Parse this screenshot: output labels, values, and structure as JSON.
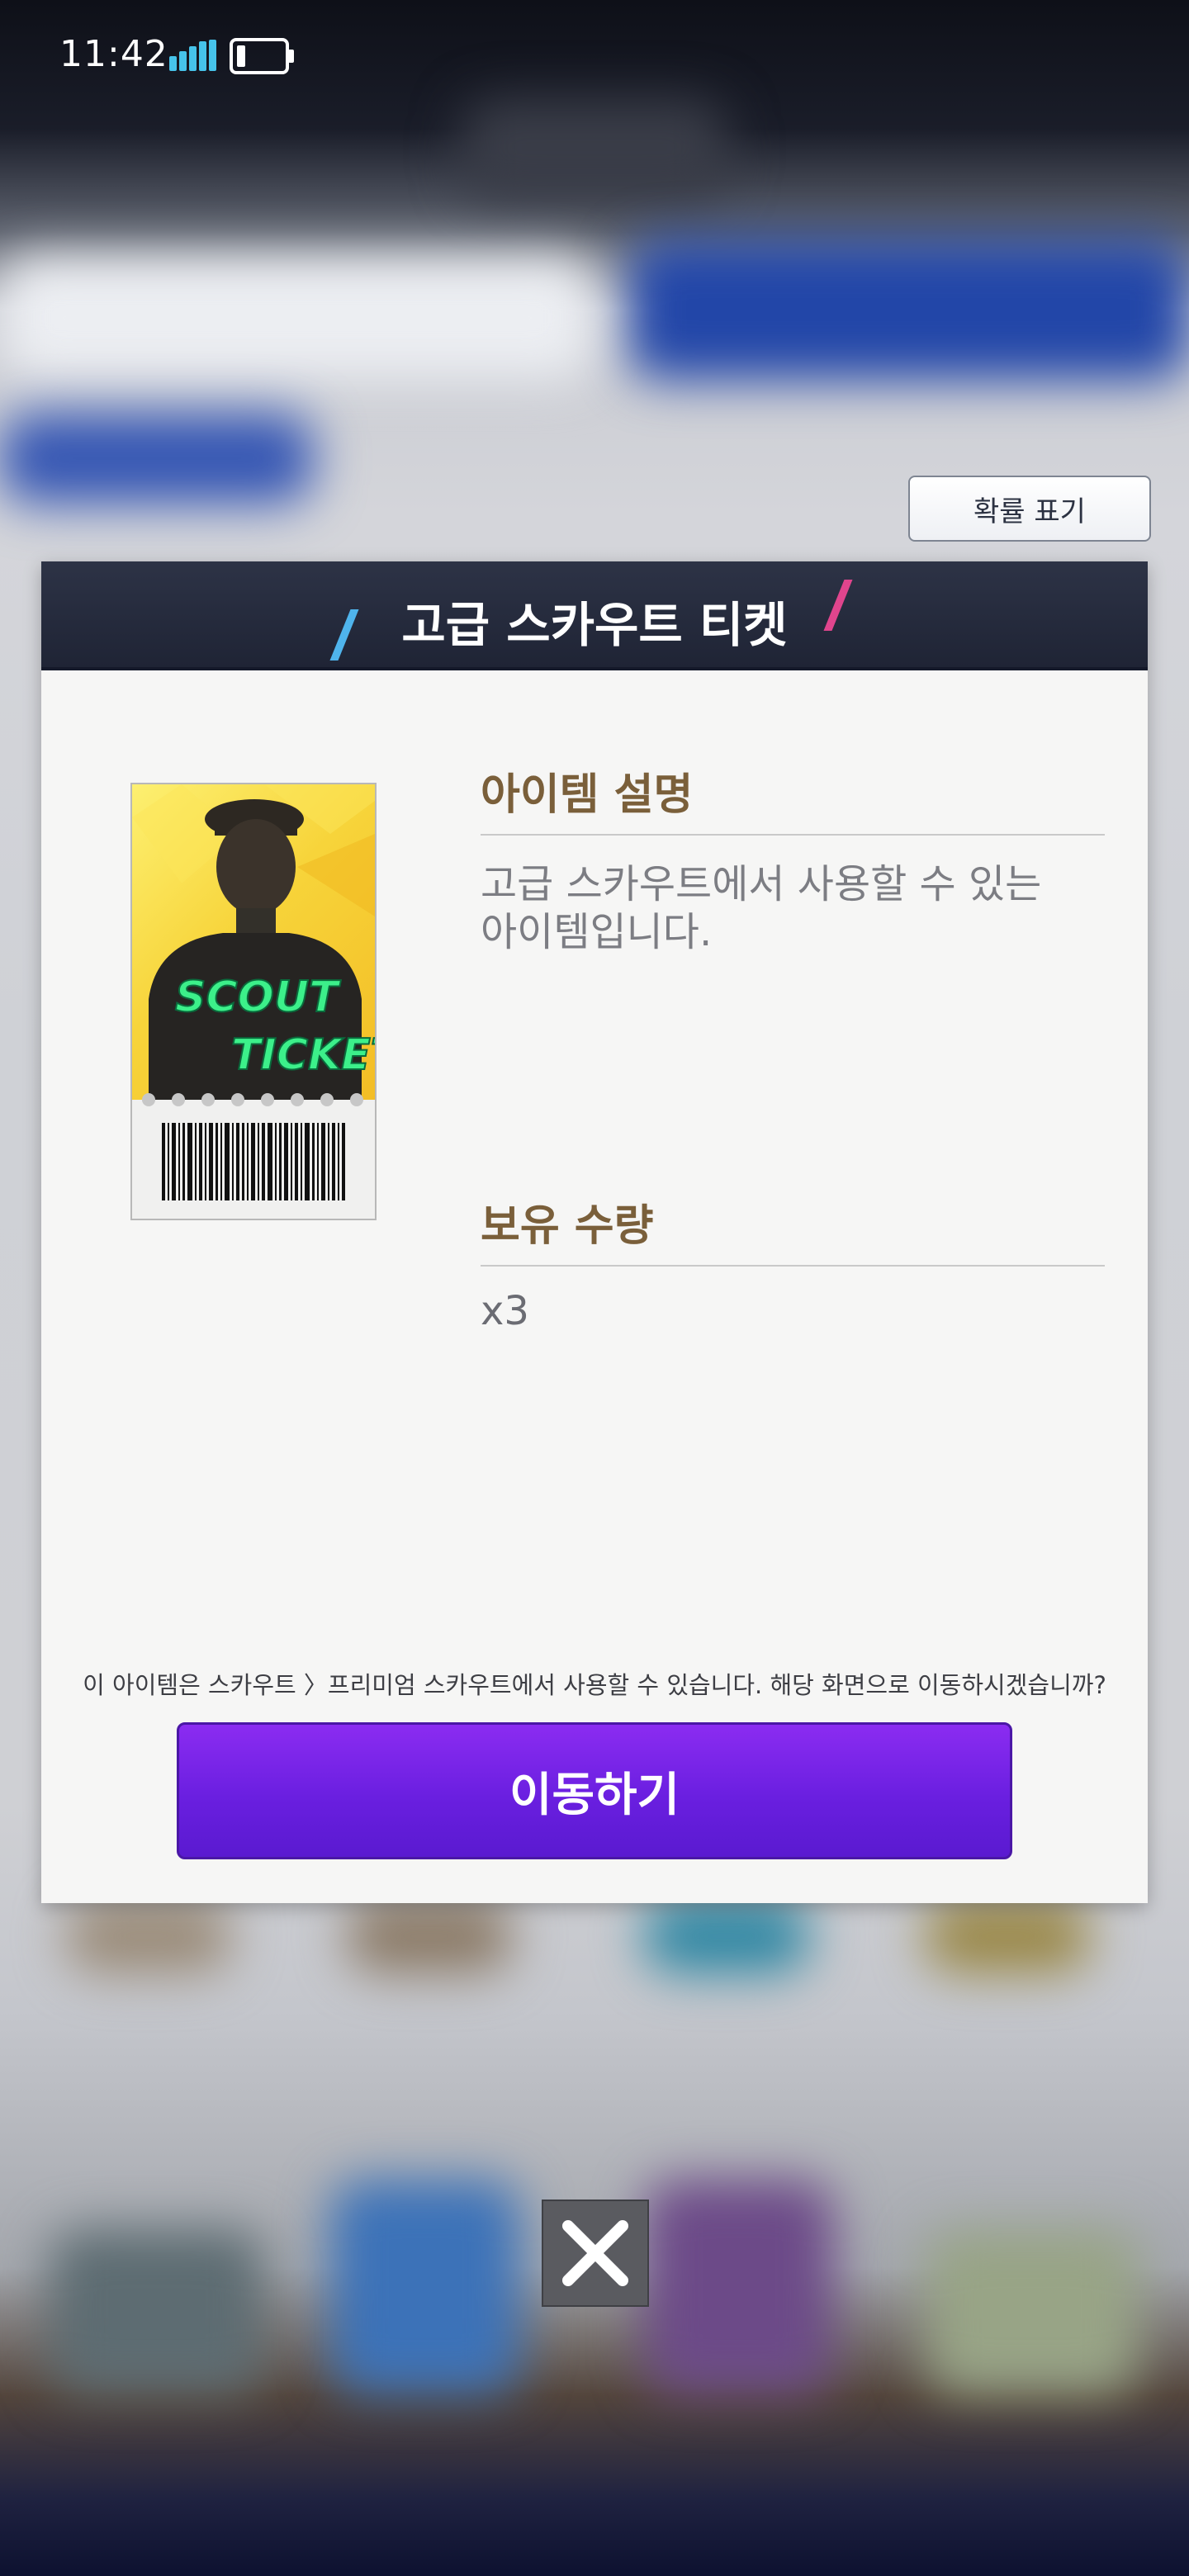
{
  "status_bar": {
    "time": "11:42"
  },
  "probability_button": {
    "label": "확률 표기"
  },
  "dialog": {
    "title": "고급 스카우트 티켓",
    "item_image_text_top": "SCOUT",
    "item_image_text_bottom": "TICKET",
    "description_heading": "아이템 설명",
    "description_line1": "고급 스카우트에서 사용할 수 있는",
    "description_line2": "아이템입니다.",
    "quantity_heading": "보유 수량",
    "quantity_value": "x3",
    "notice": "이 아이템은 스카우트 〉프리미엄 스카우트에서 사용할 수 있습니다. 해당 화면으로 이동하시겠습니까?",
    "move_button_label": "이동하기"
  },
  "colors": {
    "header_bg": "#2d3346",
    "accent_purple": "#6a1fe0",
    "heading_brown": "#7a5f3a",
    "slash_blue": "#4fb4ec",
    "slash_pink": "#e0458d"
  },
  "icons": {
    "close": "close-icon",
    "signal": "signal-icon",
    "battery": "battery-icon"
  }
}
